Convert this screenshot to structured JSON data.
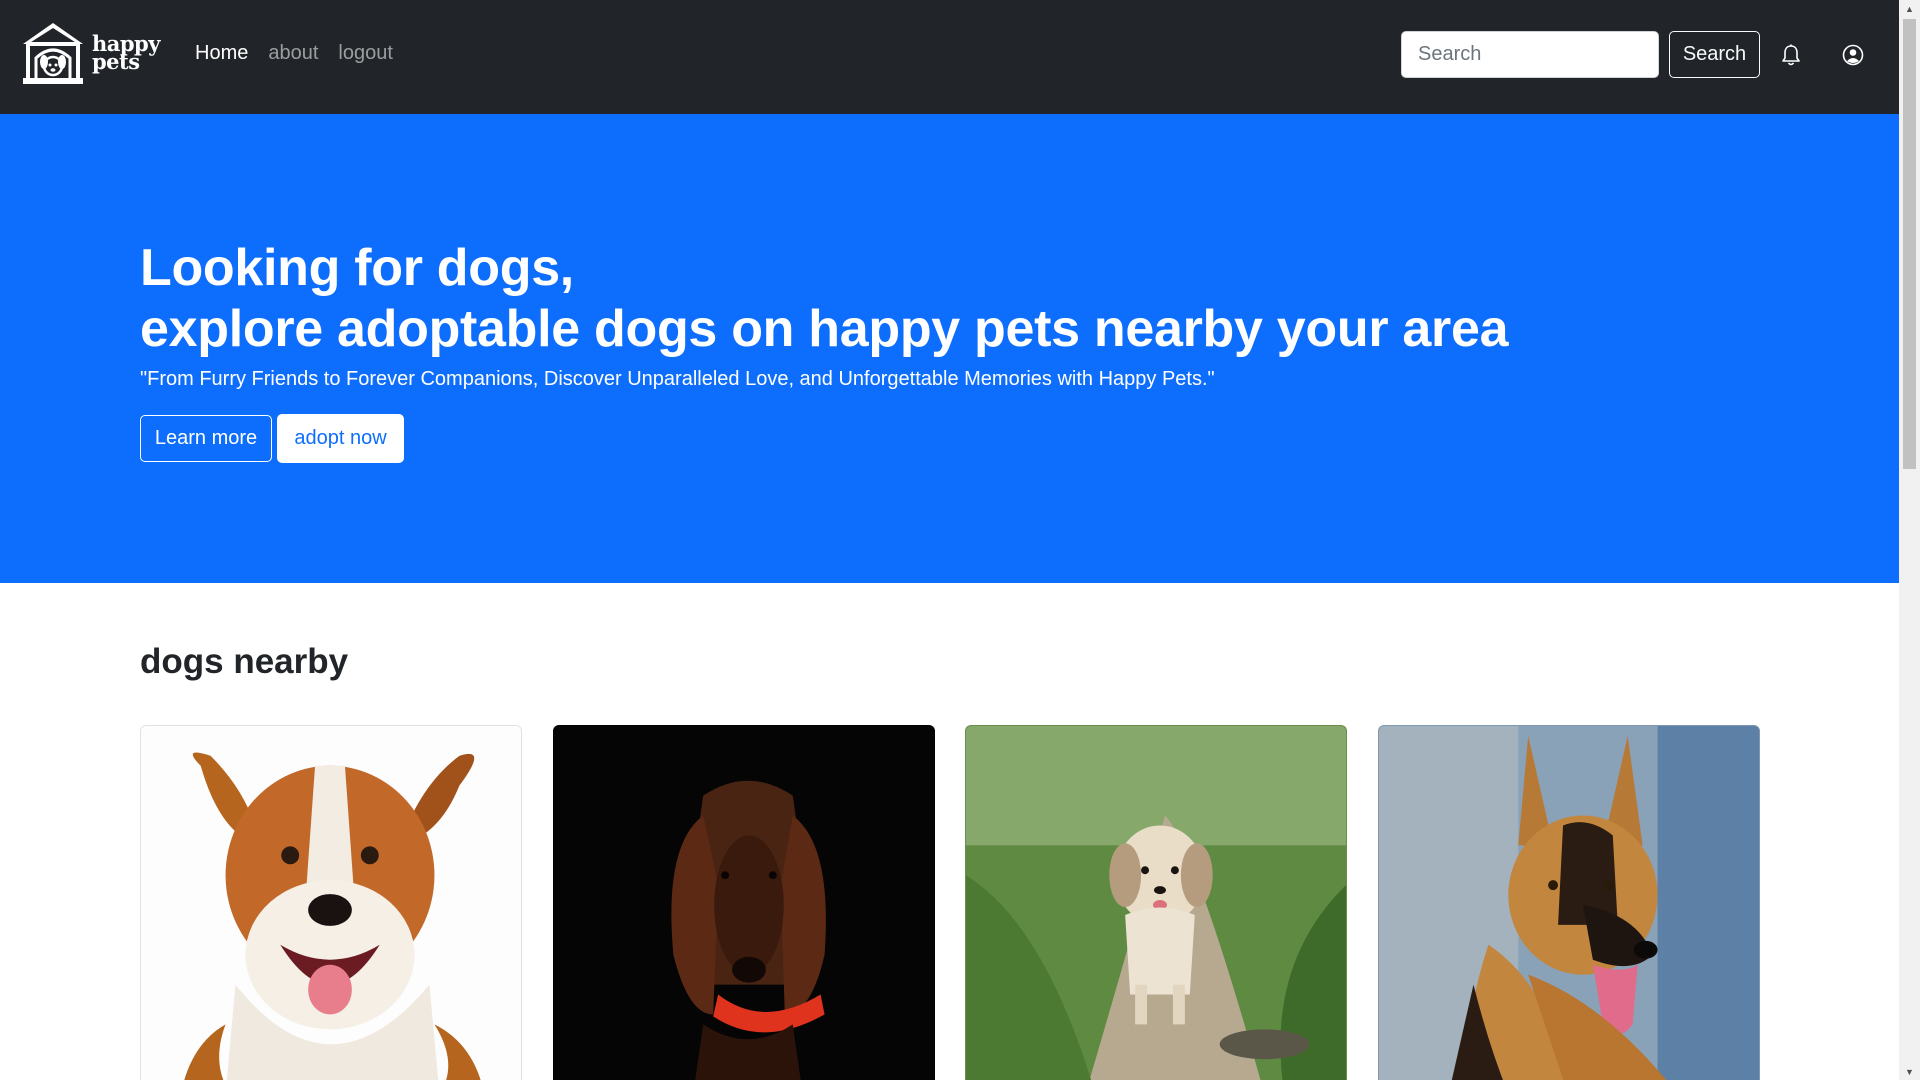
{
  "brand": {
    "line1": "happy",
    "line2": "pets",
    "logo_icon": "doghouse-logo-icon"
  },
  "nav": {
    "links": [
      {
        "label": "Home",
        "active": true
      },
      {
        "label": "about",
        "active": false
      },
      {
        "label": "logout",
        "active": false
      }
    ],
    "search": {
      "placeholder": "Search",
      "button_label": "Search"
    },
    "icons": [
      "bell-icon",
      "user-circle-icon"
    ]
  },
  "hero": {
    "title_line1": "Looking for dogs,",
    "title_line2": "explore adoptable dogs on happy pets nearby your area",
    "quote": "\"From Furry Friends to Forever Companions, Discover Unparalleled Love, and Unforgettable Memories with Happy Pets.\"",
    "learn_more_label": "Learn more",
    "adopt_now_label": "adopt now",
    "background_color": "#0d6efd"
  },
  "section": {
    "title": "dogs nearby",
    "cards": [
      {
        "image": "happy-brown-white-puppy-photo"
      },
      {
        "image": "irish-setter-red-collar-photo"
      },
      {
        "image": "shih-tzu-walking-path-photo"
      },
      {
        "image": "german-shepherd-photo"
      }
    ]
  },
  "colors": {
    "navbar": "#212529",
    "accent": "#0d6efd",
    "text": "#212529"
  }
}
